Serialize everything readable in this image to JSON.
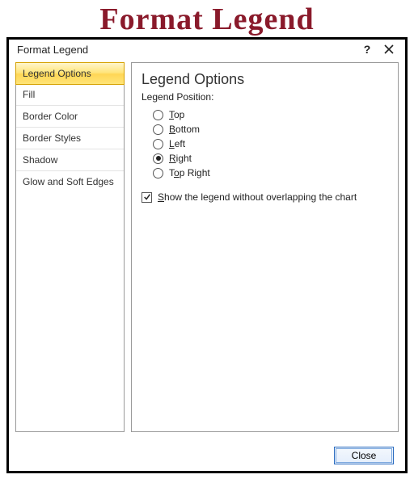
{
  "page_heading": "Format Legend",
  "dialog": {
    "title": "Format Legend",
    "help_tooltip": "?",
    "close_tooltip": "Close"
  },
  "nav": {
    "items": [
      {
        "label": "Legend Options",
        "selected": true
      },
      {
        "label": "Fill",
        "selected": false
      },
      {
        "label": "Border Color",
        "selected": false
      },
      {
        "label": "Border Styles",
        "selected": false
      },
      {
        "label": "Shadow",
        "selected": false
      },
      {
        "label": "Glow and Soft Edges",
        "selected": false
      }
    ]
  },
  "pane": {
    "heading": "Legend Options",
    "subhead": "Legend Position:",
    "positions": [
      {
        "key": "top",
        "label": "Top",
        "u": "T",
        "rest": "op",
        "checked": false
      },
      {
        "key": "bottom",
        "label": "Bottom",
        "u": "B",
        "rest": "ottom",
        "checked": false
      },
      {
        "key": "left",
        "label": "Left",
        "u": "L",
        "rest": "eft",
        "checked": false
      },
      {
        "key": "right",
        "label": "Right",
        "u": "R",
        "rest": "ight",
        "checked": true
      },
      {
        "key": "topright",
        "label": "Top Right",
        "u": "o",
        "pre": "T",
        "rest": "p Right",
        "checked": false
      }
    ],
    "overlap": {
      "checked": true,
      "pre": "",
      "u": "S",
      "rest": "how the legend without overlapping the chart"
    }
  },
  "buttons": {
    "close": "Close"
  }
}
